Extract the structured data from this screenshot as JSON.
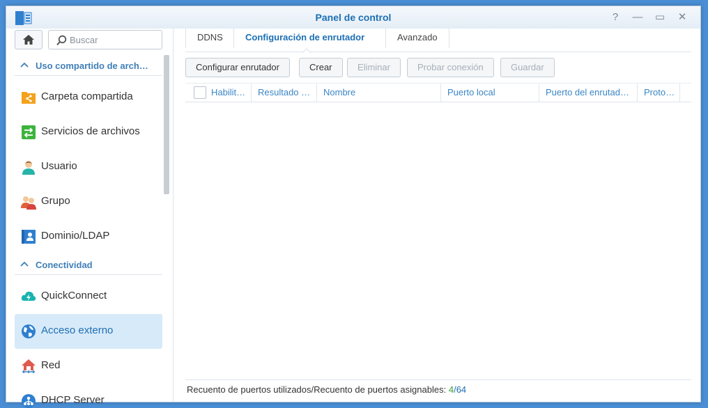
{
  "window": {
    "title": "Panel de control",
    "controls": {
      "help": "?",
      "minimize": "—",
      "maximize": "▭",
      "close": "✕"
    }
  },
  "sidebar": {
    "search_placeholder": "Buscar",
    "sections": [
      {
        "label": "Uso compartido de arch…"
      },
      {
        "label": "Conectividad"
      }
    ],
    "items": [
      {
        "label": "Carpeta compartida",
        "icon": "shared-folder-icon"
      },
      {
        "label": "Servicios de archivos",
        "icon": "file-services-icon"
      },
      {
        "label": "Usuario",
        "icon": "user-icon"
      },
      {
        "label": "Grupo",
        "icon": "group-icon"
      },
      {
        "label": "Dominio/LDAP",
        "icon": "domain-ldap-icon"
      },
      {
        "label": "QuickConnect",
        "icon": "quickconnect-icon"
      },
      {
        "label": "Acceso externo",
        "icon": "globe-icon",
        "active": true
      },
      {
        "label": "Red",
        "icon": "network-house-icon"
      },
      {
        "label": "DHCP Server",
        "icon": "dhcp-server-icon"
      }
    ]
  },
  "tabs": [
    {
      "label": "DDNS"
    },
    {
      "label": "Configuración de enrutador",
      "active": true
    },
    {
      "label": "Avanzado"
    }
  ],
  "toolbar": {
    "configure": "Configurar enrutador",
    "create": "Crear",
    "delete": "Eliminar",
    "test": "Probar conexión",
    "save": "Guardar"
  },
  "grid": {
    "columns": [
      "Habilit…",
      "Resultado …",
      "Nombre",
      "Puerto local",
      "Puerto del enrutad…",
      "Proto…"
    ],
    "rows": []
  },
  "footer": {
    "label": "Recuento de puertos utilizados/Recuento de puertos asignables:",
    "used": "4",
    "separator": "/",
    "total": "64"
  },
  "colors": {
    "accent": "#1d6fb3",
    "active_bg": "#d7eaf9",
    "used_count": "#3aa033"
  }
}
